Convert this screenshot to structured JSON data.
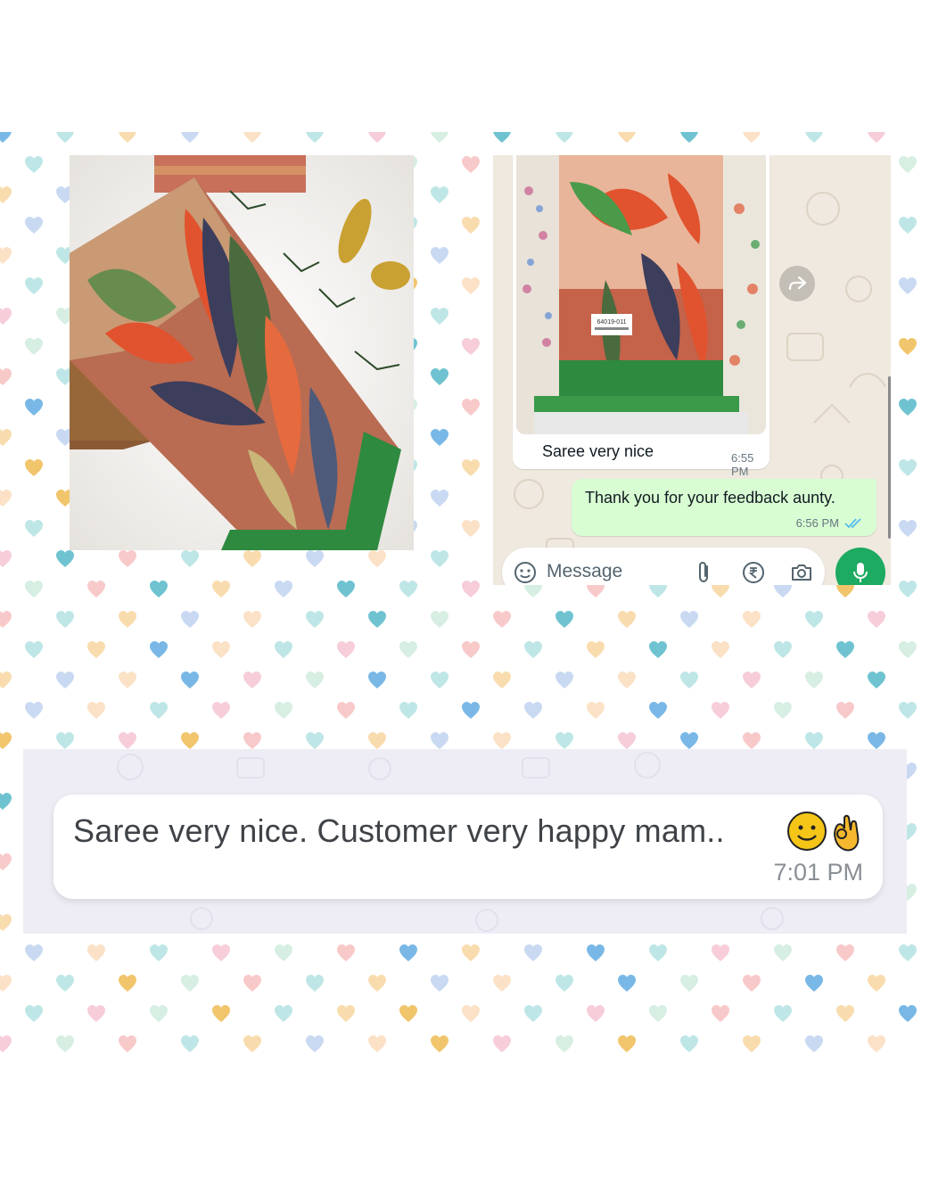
{
  "collage": {
    "product_photo_alt": "saree-product-photo",
    "chat": {
      "incoming": {
        "caption": "Saree very nice",
        "time": "6:55 PM",
        "tag_label": "64019-011"
      },
      "outgoing": {
        "text": "Thank you for your feedback aunty.",
        "time": "6:56 PM",
        "status": "read"
      },
      "composer": {
        "placeholder": "Message"
      }
    },
    "review": {
      "text": "Saree very nice. Customer very happy mam..",
      "time": "7:01 PM"
    }
  },
  "colors": {
    "outgoing_bubble": "#d9fdd3",
    "mic_button": "#1daa61",
    "read_ticks": "#53bdeb",
    "chat_bg": "#efe9df"
  },
  "icons": [
    "forward-icon",
    "sticker-icon",
    "attach-icon",
    "rupee-icon",
    "camera-icon",
    "mic-icon",
    "double-check-icon",
    "smile-emoji-icon",
    "ok-hand-emoji-icon"
  ]
}
